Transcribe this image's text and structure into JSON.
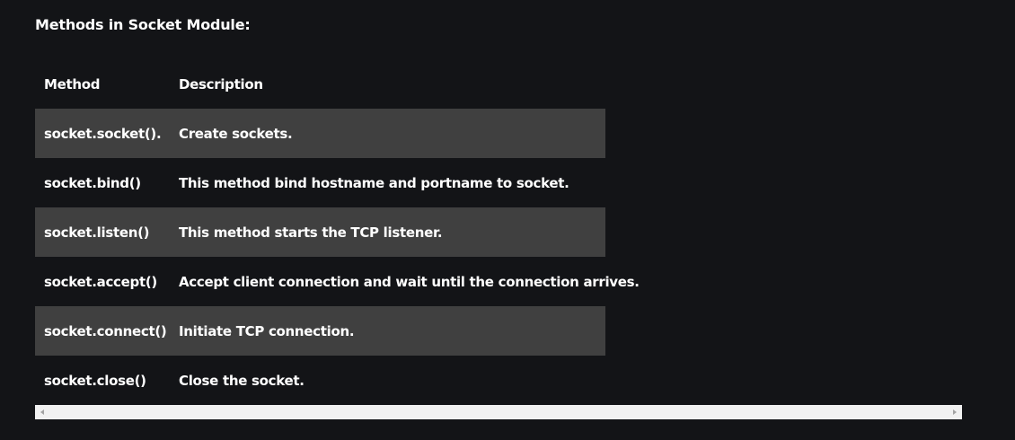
{
  "heading": "Methods in Socket Module:",
  "table": {
    "headers": [
      "Method",
      "Description"
    ],
    "rows": [
      {
        "method": "socket.socket().",
        "description": "Create sockets."
      },
      {
        "method": "socket.bind()",
        "description": "This method bind hostname and portname to socket."
      },
      {
        "method": "socket.listen()",
        "description": "This method starts the TCP listener."
      },
      {
        "method": "socket.accept()",
        "description": "Accept client connection and wait until the connection arrives."
      },
      {
        "method": "socket.connect()",
        "description": "Initiate TCP connection."
      },
      {
        "method": "socket.close()",
        "description": "Close the socket."
      }
    ]
  },
  "colors": {
    "background": "#131417",
    "row_shade": "#404040",
    "text": "#ffffff",
    "scrollbar_track": "#f1f1f1",
    "scrollbar_arrow": "#a3a3a3"
  },
  "icons": {
    "scroll_left": "scroll-left-arrow-icon",
    "scroll_right": "scroll-right-arrow-icon"
  }
}
